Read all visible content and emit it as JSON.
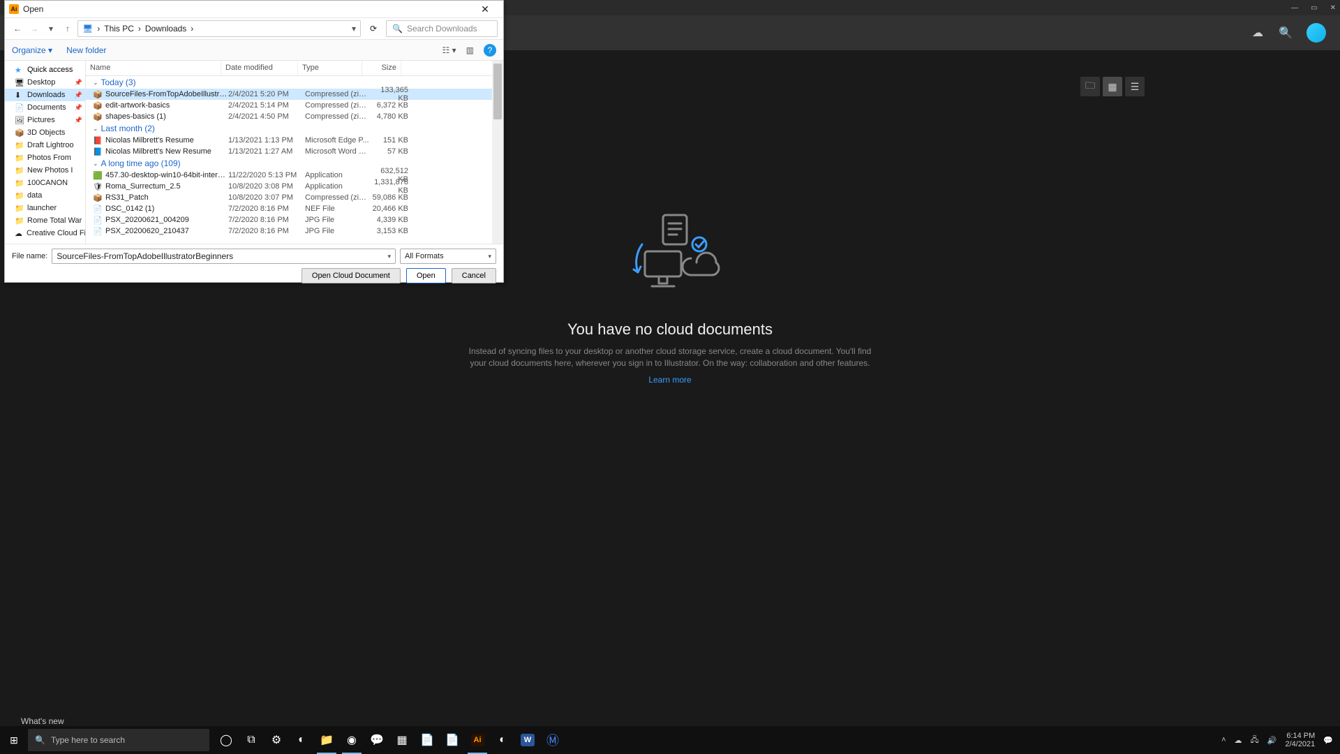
{
  "ai": {
    "window_controls": {
      "min": "—",
      "restore": "▭",
      "close": "✕"
    },
    "cloud": {
      "heading": "You have no cloud documents",
      "body": "Instead of syncing files to your desktop or another cloud storage service, create a cloud document. You'll find your cloud documents here, wherever you sign in to Illustrator. On the way: collaboration and other features.",
      "learn_more": "Learn more"
    },
    "whats_new": "What's new"
  },
  "dialog": {
    "title": "Open",
    "breadcrumb": [
      "This PC",
      "Downloads"
    ],
    "search_placeholder": "Search Downloads",
    "organize": "Organize",
    "new_folder": "New folder",
    "columns": {
      "name": "Name",
      "date": "Date modified",
      "type": "Type",
      "size": "Size"
    },
    "tree": [
      {
        "label": "Quick access",
        "icon": "★",
        "kind": "qa"
      },
      {
        "label": "Desktop",
        "icon": "🖥",
        "pin": true
      },
      {
        "label": "Downloads",
        "icon": "⬇",
        "pin": true,
        "selected": true
      },
      {
        "label": "Documents",
        "icon": "📄",
        "pin": true
      },
      {
        "label": "Pictures",
        "icon": "🖼",
        "pin": true
      },
      {
        "label": "3D Objects",
        "icon": "📦"
      },
      {
        "label": "Draft Lightroo",
        "icon": "📁"
      },
      {
        "label": "Photos From",
        "icon": "📁"
      },
      {
        "label": "New Photos I",
        "icon": "📁"
      },
      {
        "label": "100CANON",
        "icon": "📁"
      },
      {
        "label": "data",
        "icon": "📁"
      },
      {
        "label": "launcher",
        "icon": "📁"
      },
      {
        "label": "Rome Total War",
        "icon": "📁"
      },
      {
        "label": "Creative Cloud Fil",
        "icon": "☁"
      }
    ],
    "groups": [
      {
        "title": "Today (3)",
        "rows": [
          {
            "icon": "📦",
            "name": "SourceFiles-FromTopAdobeIllustratorBeg...",
            "date": "2/4/2021 5:20 PM",
            "type": "Compressed (zipp...",
            "size": "133,365 KB",
            "selected": true
          },
          {
            "icon": "📦",
            "name": "edit-artwork-basics",
            "date": "2/4/2021 5:14 PM",
            "type": "Compressed (zipp...",
            "size": "6,372 KB"
          },
          {
            "icon": "📦",
            "name": "shapes-basics (1)",
            "date": "2/4/2021 4:50 PM",
            "type": "Compressed (zipp...",
            "size": "4,780 KB"
          }
        ]
      },
      {
        "title": "Last month (2)",
        "rows": [
          {
            "icon": "📕",
            "name": "Nicolas Milbrett's Resume",
            "date": "1/13/2021 1:13 PM",
            "type": "Microsoft Edge P...",
            "size": "151 KB"
          },
          {
            "icon": "📘",
            "name": "Nicolas Milbrett's New Resume",
            "date": "1/13/2021 1:27 AM",
            "type": "Microsoft Word D...",
            "size": "57 KB"
          }
        ]
      },
      {
        "title": "A long time ago (109)",
        "rows": [
          {
            "icon": "🟩",
            "name": "457.30-desktop-win10-64bit-internationa...",
            "date": "11/22/2020 5:13 PM",
            "type": "Application",
            "size": "632,512 KB"
          },
          {
            "icon": "🛡",
            "name": "Roma_Surrectum_2.5",
            "date": "10/8/2020 3:08 PM",
            "type": "Application",
            "size": "1,331,878 KB"
          },
          {
            "icon": "📦",
            "name": "RS31_Patch",
            "date": "10/8/2020 3:07 PM",
            "type": "Compressed (zipp...",
            "size": "59,086 KB"
          },
          {
            "icon": "📄",
            "name": "DSC_0142 (1)",
            "date": "7/2/2020 8:16 PM",
            "type": "NEF File",
            "size": "20,466 KB"
          },
          {
            "icon": "📄",
            "name": "PSX_20200621_004209",
            "date": "7/2/2020 8:16 PM",
            "type": "JPG File",
            "size": "4,339 KB"
          },
          {
            "icon": "📄",
            "name": "PSX_20200620_210437",
            "date": "7/2/2020 8:16 PM",
            "type": "JPG File",
            "size": "3,153 KB"
          }
        ]
      }
    ],
    "file_name_label": "File name:",
    "file_name_value": "SourceFiles-FromTopAdobeIllustratorBeginners",
    "format": "All Formats",
    "buttons": {
      "cloud": "Open Cloud Document",
      "open": "Open",
      "cancel": "Cancel"
    }
  },
  "taskbar": {
    "search_placeholder": "Type here to search",
    "time": "6:14 PM",
    "date": "2/4/2021",
    "icons": [
      "◯",
      "⧉",
      "⚙",
      "◐",
      "📁",
      "◉",
      "💬",
      "▦",
      "📄",
      "📄",
      "Ai",
      "◐",
      "W",
      "M"
    ]
  }
}
